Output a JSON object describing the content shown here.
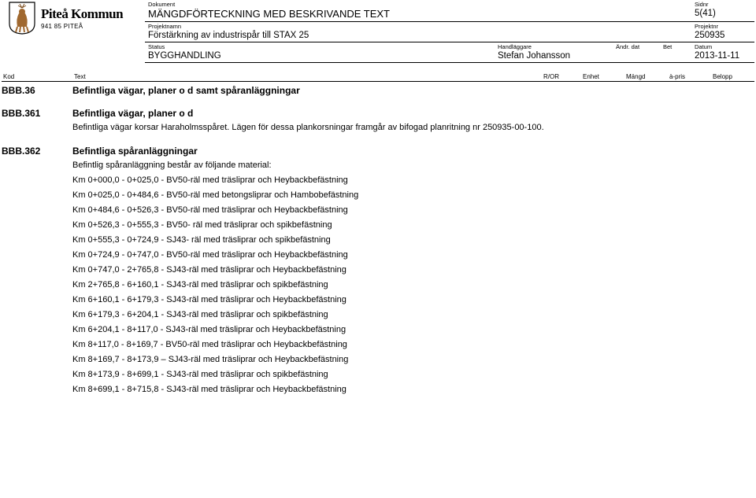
{
  "logo": {
    "name": "Piteå Kommun",
    "post": "941 85 PITEÅ"
  },
  "header": {
    "dokument_lbl": "Dokument",
    "dokument": "MÄNGDFÖRTECKNING MED BESKRIVANDE TEXT",
    "sidnr_lbl": "Sidnr",
    "sidnr": "5(41)",
    "projektnamn_lbl": "Projektnamn",
    "projektnamn": "Förstärkning av industrispår till STAX 25",
    "projektnr_lbl": "Projektnr",
    "projektnr": "250935",
    "status_lbl": "Status",
    "status": "BYGGHANDLING",
    "handlaggare_lbl": "Handläggare",
    "handlaggare": "Stefan Johansson",
    "andrdat_lbl": "Ändr. dat",
    "andrdat": "",
    "bet_lbl": "Bet",
    "bet": "",
    "datum_lbl": "Datum",
    "datum": "2013-11-11"
  },
  "cols": {
    "kod": "Kod",
    "text": "Text",
    "ror": "R/OR",
    "enhet": "Enhet",
    "mangd": "Mängd",
    "apris": "à-pris",
    "belopp": "Belopp"
  },
  "rows": {
    "r1_kod": "BBB.36",
    "r1_head": "Befintliga vägar, planer o d samt spåranläggningar",
    "r2_kod": "BBB.361",
    "r2_head": "Befintliga vägar, planer o d",
    "r2_p1": "Befintliga vägar korsar Haraholmsspåret. Lägen för dessa plankorsningar framgår av bifogad planritning nr 250935-00-100.",
    "r3_kod": "BBB.362",
    "r3_head": "Befintliga spåranläggningar",
    "r3_p1": "Befintlig spåranläggning består av följande material:",
    "r3_items": [
      "Km 0+000,0 - 0+025,0 - BV50-räl med träsliprar och Heybackbefästning",
      "Km 0+025,0 - 0+484,6 - BV50-räl med betongsliprar och Hambobefästning",
      "Km 0+484,6 - 0+526,3 - BV50-räl med träsliprar och Heybackbefästning",
      "Km 0+526,3 - 0+555,3 - BV50- räl med träsliprar och spikbefästning",
      "Km 0+555,3 - 0+724,9 - SJ43- räl med träsliprar och spikbefästning",
      "Km 0+724,9 - 0+747,0 - BV50-räl med träsliprar och Heybackbefästning",
      "Km 0+747,0 - 2+765,8 - SJ43-räl med träsliprar och Heybackbefästning",
      "Km 2+765,8 - 6+160,1 - SJ43-räl med träsliprar och spikbefästning",
      "Km 6+160,1 - 6+179,3 - SJ43-räl med träsliprar och Heybackbefästning",
      "Km 6+179,3 - 6+204,1 - SJ43-räl med träsliprar och spikbefästning",
      "Km 6+204,1 - 8+117,0 - SJ43-räl med träsliprar och Heybackbefästning",
      "Km 8+117,0 - 8+169,7 - BV50-räl med träsliprar och Heybackbefästning",
      "Km 8+169,7 - 8+173,9 – SJ43-räl med träsliprar och Heybackbefästning",
      "Km 8+173,9 - 8+699,1 - SJ43-räl med träsliprar och spikbefästning",
      "Km 8+699,1 - 8+715,8 - SJ43-räl med träsliprar och Heybackbefästning"
    ]
  }
}
